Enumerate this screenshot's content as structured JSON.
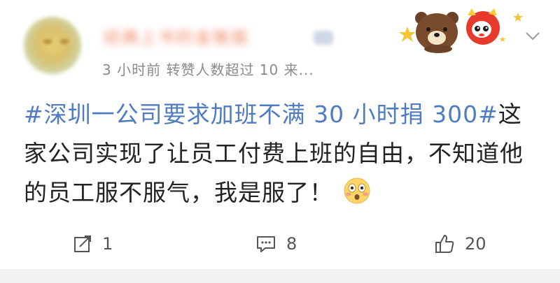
{
  "post": {
    "author": {
      "name": "经典上书的金晚报"
    },
    "meta": "3 小时前  转赞人数超过 10  来...",
    "hashtag": "#深圳一公司要求加班不满 30 小时捐 300#",
    "body": "这家公司实现了让员工付费上班的自由，不知道他的员工服不服气，我是服了！",
    "emoji": "astonished-face-emoji"
  },
  "actions": {
    "repost_count": "1",
    "comment_count": "8",
    "like_count": "20"
  },
  "colors": {
    "hashtag": "#4f7cc0",
    "text": "#222222",
    "meta": "#8a8a8a"
  }
}
